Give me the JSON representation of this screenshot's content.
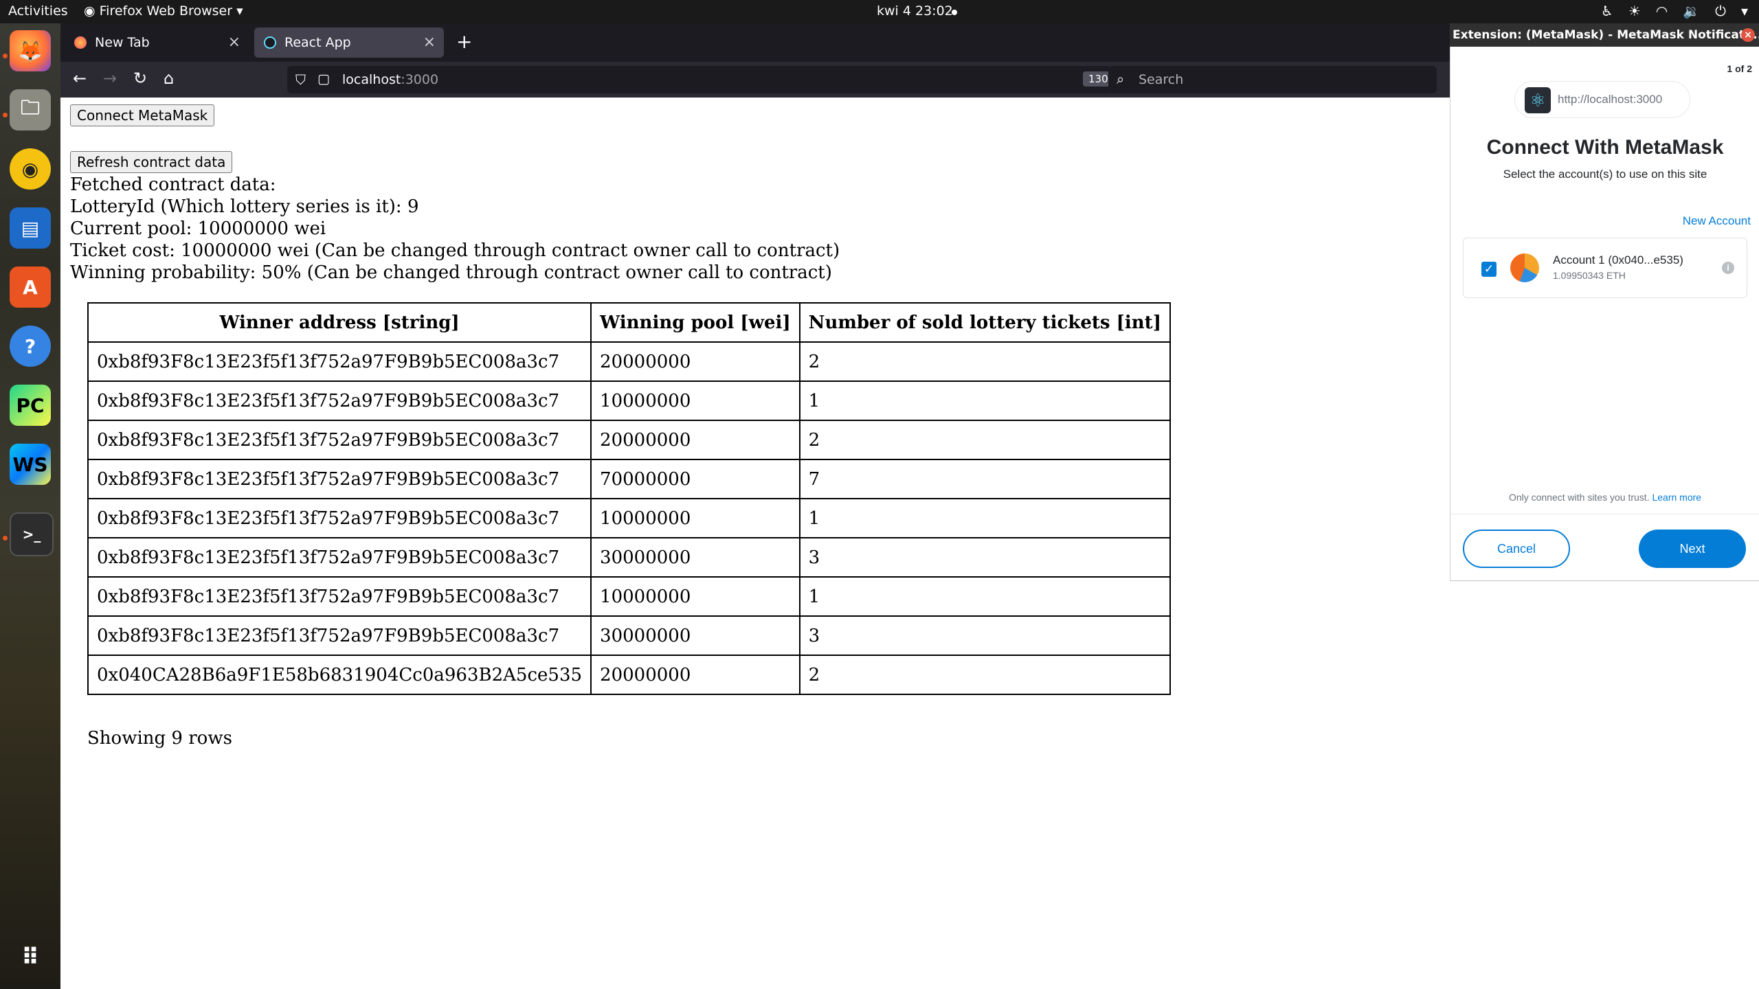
{
  "topbar": {
    "activities": "Activities",
    "app_menu": "Firefox Web Browser",
    "clock": "kwi 4  23:02"
  },
  "dock": {
    "icons": [
      "firefox-icon",
      "files-icon",
      "rhythmbox-icon",
      "writer-icon",
      "software-icon",
      "help-icon",
      "pycharm-icon",
      "webstorm-icon",
      "terminal-icon",
      "app-grid-icon"
    ]
  },
  "browser": {
    "tabs": [
      {
        "label": "New Tab"
      },
      {
        "label": "React App"
      }
    ],
    "url_host": "localhost",
    "url_port": ":3000",
    "zoom": "130%",
    "search_placeholder": "Search"
  },
  "page": {
    "connect_button": "Connect MetaMask",
    "refresh_button": "Refresh contract data",
    "info_lines": [
      "Fetched contract data:",
      "LotteryId (Which lottery series is it): 9",
      "Current pool: 10000000 wei",
      "Ticket cost: 10000000 wei (Can be changed through contract owner call to contract)",
      "Winning probability: 50% (Can be changed through contract owner call to contract)"
    ],
    "table": {
      "headers": [
        "Winner address [string]",
        "Winning pool [wei]",
        "Number of sold lottery tickets [int]"
      ],
      "rows": [
        [
          "0xb8f93F8c13E23f5f13f752a97F9B9b5EC008a3c7",
          "20000000",
          "2"
        ],
        [
          "0xb8f93F8c13E23f5f13f752a97F9B9b5EC008a3c7",
          "10000000",
          "1"
        ],
        [
          "0xb8f93F8c13E23f5f13f752a97F9B9b5EC008a3c7",
          "20000000",
          "2"
        ],
        [
          "0xb8f93F8c13E23f5f13f752a97F9B9b5EC008a3c7",
          "70000000",
          "7"
        ],
        [
          "0xb8f93F8c13E23f5f13f752a97F9B9b5EC008a3c7",
          "10000000",
          "1"
        ],
        [
          "0xb8f93F8c13E23f5f13f752a97F9B9b5EC008a3c7",
          "30000000",
          "3"
        ],
        [
          "0xb8f93F8c13E23f5f13f752a97F9B9b5EC008a3c7",
          "10000000",
          "1"
        ],
        [
          "0xb8f93F8c13E23f5f13f752a97F9B9b5EC008a3c7",
          "30000000",
          "3"
        ],
        [
          "0x040CA28B6a9F1E58b6831904Cc0a963B2A5ce535",
          "20000000",
          "2"
        ]
      ]
    },
    "row_count": "Showing 9 rows"
  },
  "metamask": {
    "window_title": "Extension: (MetaMask) - MetaMask Notificati...",
    "page_count": "1 of 2",
    "site_url": "http://localhost:3000",
    "heading": "Connect With MetaMask",
    "subheading": "Select the account(s) to use on this site",
    "new_account": "New Account",
    "account_name": "Account 1 (0x040...e535)",
    "account_balance": "1.09950343 ETH",
    "trust_text": "Only connect with sites you trust.",
    "learn_more": "Learn more",
    "cancel": "Cancel",
    "next": "Next"
  },
  "colors": {
    "metamask_blue": "#037dd6",
    "firefox_tab_bar": "#1c1b22",
    "firefox_toolbar": "#2b2a33"
  }
}
